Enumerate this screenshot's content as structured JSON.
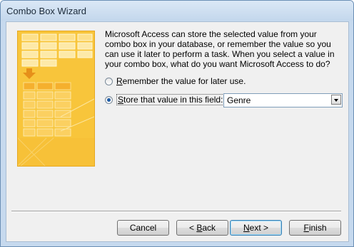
{
  "window": {
    "title": "Combo Box Wizard"
  },
  "wizard": {
    "question": "Microsoft Access can store the selected value from your combo box in your database, or remember the value so you can use it later to perform a task.  When you select a value in your combo box, what do you want Microsoft Access to do?",
    "option_remember": {
      "label_mnemonic": "R",
      "label_rest": "emember the value for later use.",
      "selected": false
    },
    "option_store": {
      "label_mnemonic": "S",
      "label_rest": "tore that value in this field:",
      "selected": true
    },
    "field_combo": {
      "value": "Genre"
    }
  },
  "buttons": {
    "cancel": "Cancel",
    "back_prefix": "< ",
    "back_mnemonic": "B",
    "back_rest": "ack",
    "next_mnemonic": "N",
    "next_rest": "ext >",
    "finish_mnemonic": "F",
    "finish_rest": "inish"
  },
  "colors": {
    "illustration": "#f8c53b",
    "illustration_dark": "#e6a820",
    "radio_dot": "#1d5ba6"
  }
}
